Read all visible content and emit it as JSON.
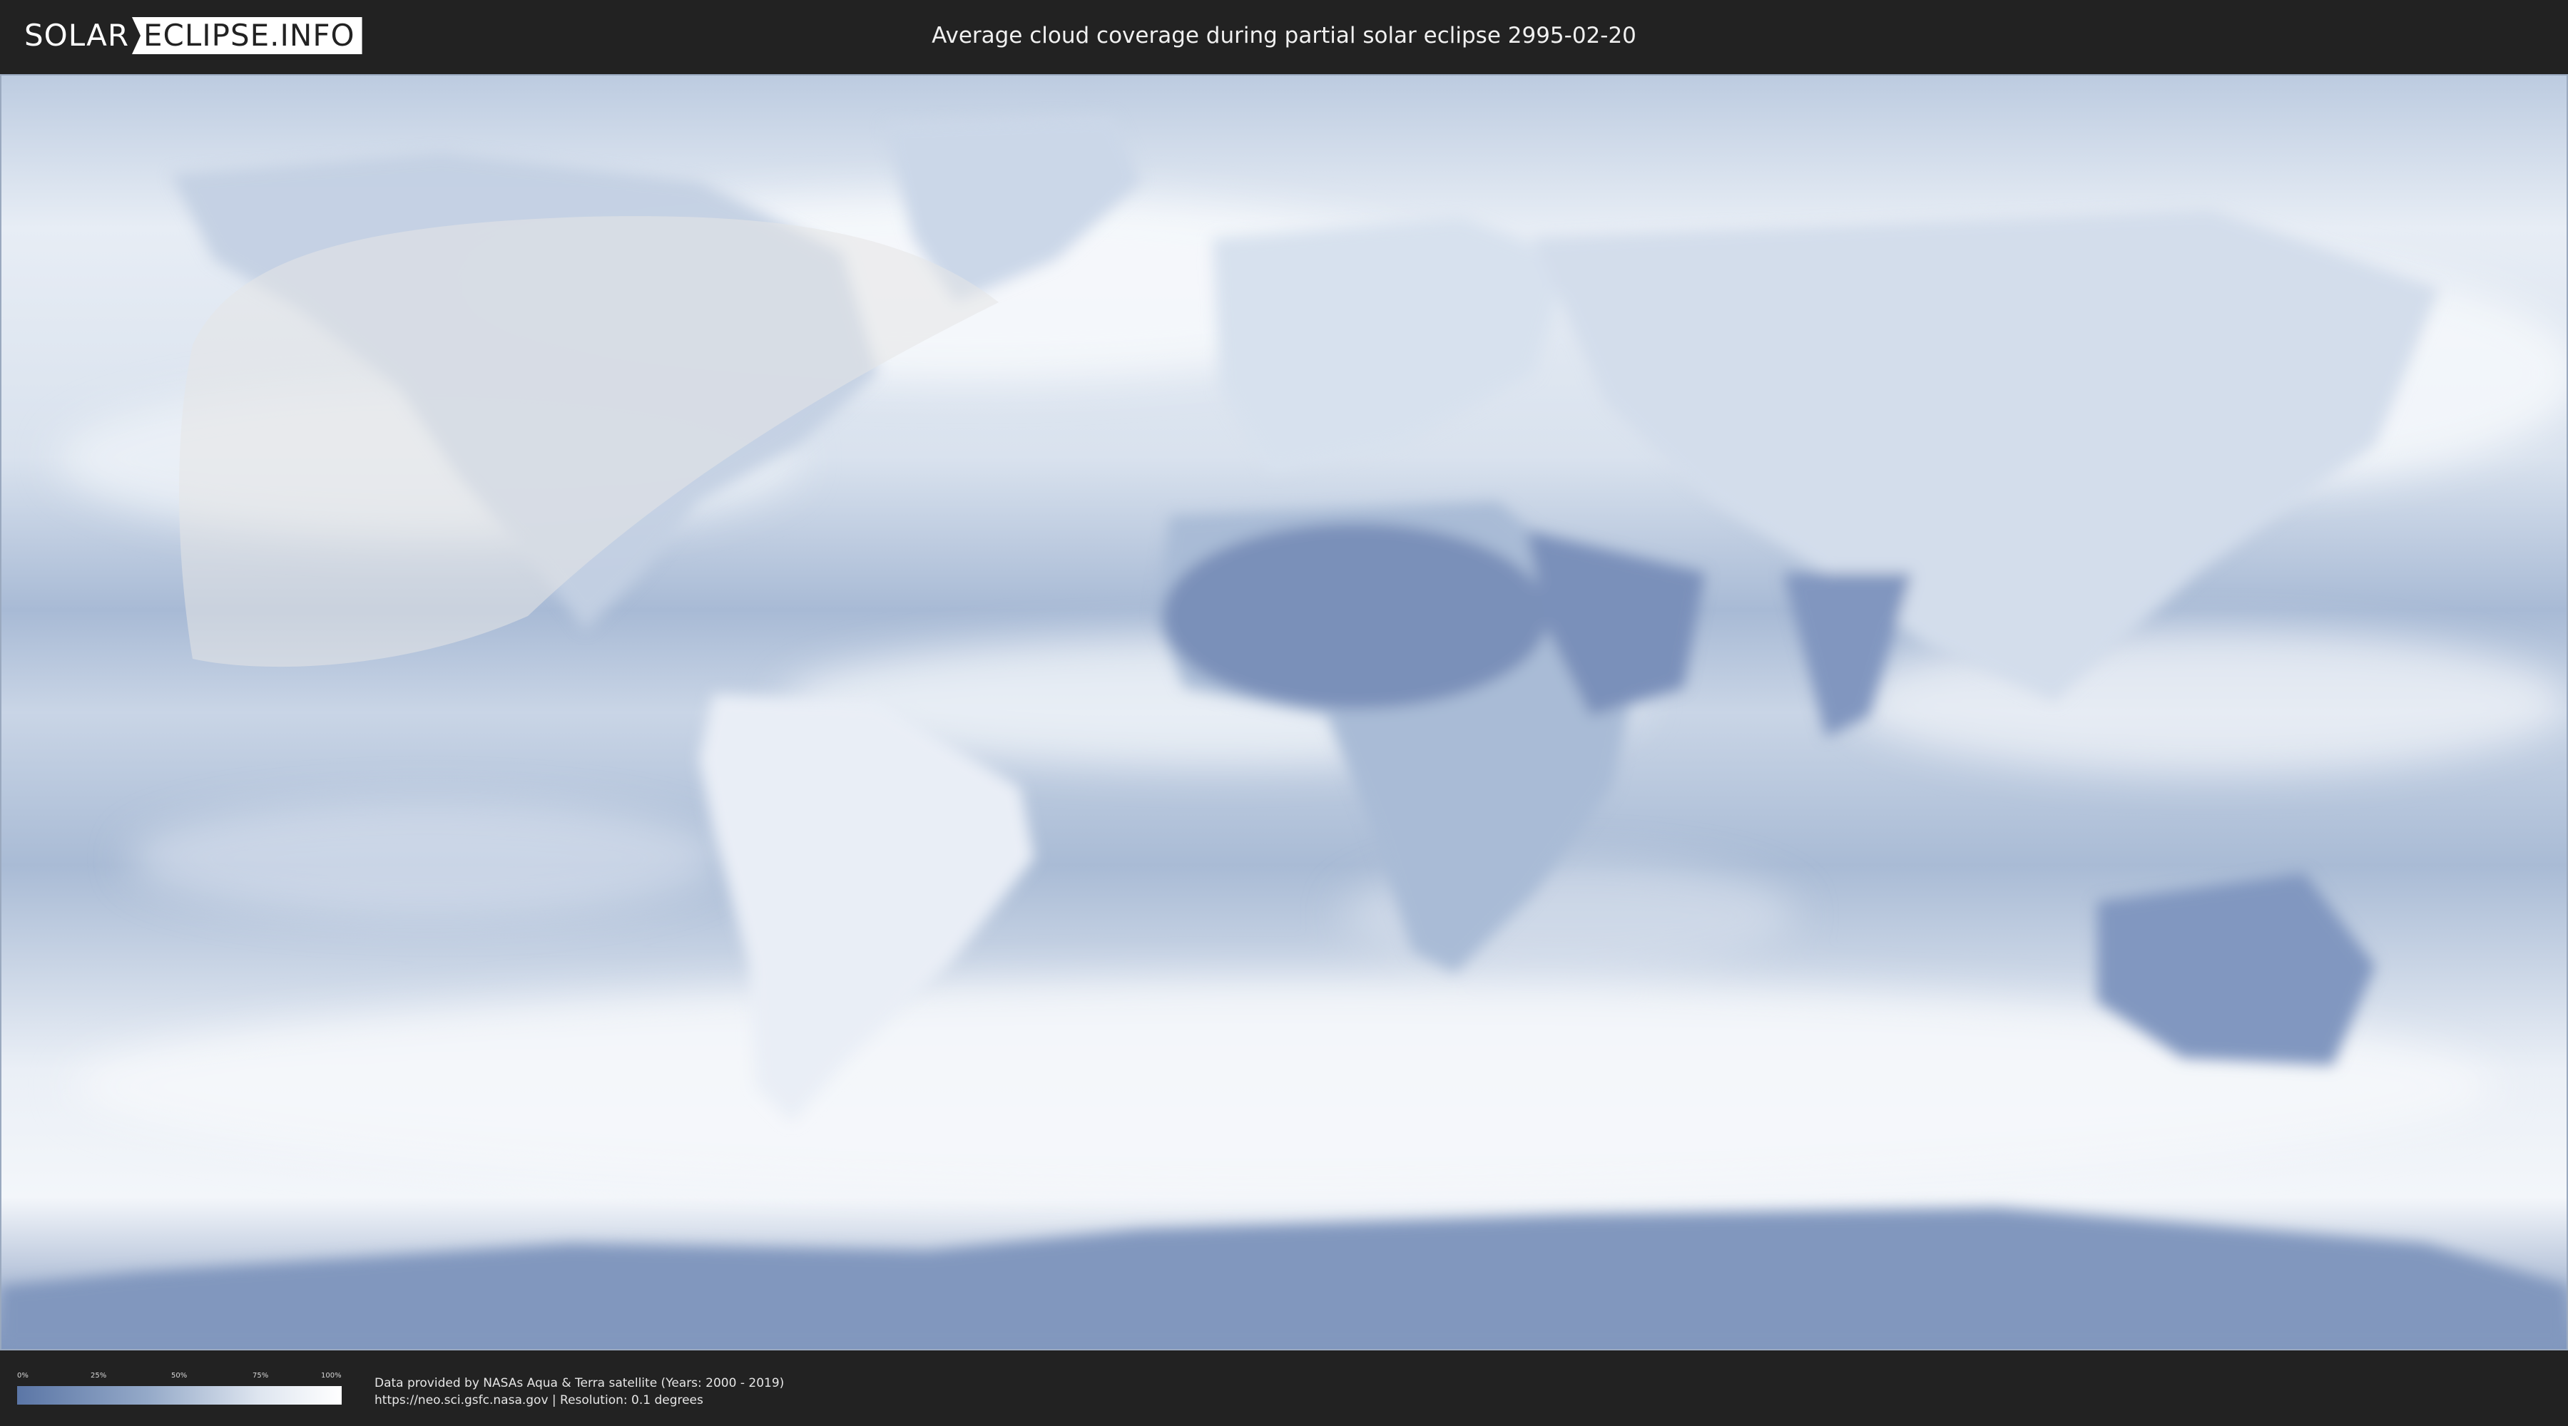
{
  "header": {
    "logo_part1": "SOLAR",
    "logo_part2": "ECLIPSE.INFO",
    "title": "Average cloud coverage during partial solar eclipse 2995-02-20"
  },
  "legend": {
    "ticks": [
      "0%",
      "25%",
      "50%",
      "75%",
      "100%"
    ],
    "colors": {
      "low": "#5b76a6",
      "mid": "#94a9c8",
      "high": "#ffffff"
    }
  },
  "footer": {
    "credit_line1": "Data provided by NASAs Aqua & Terra satellite (Years: 2000 - 2019)",
    "credit_line2": "https://neo.sci.gsfc.nasa.gov | Resolution: 0.1 degrees"
  },
  "colors": {
    "background": "#222222",
    "ocean_clear": "#8ea6c8",
    "cloud": "#f4f7fb",
    "land_clear": "#6f87b4",
    "eclipse_zone": "#e6e6e6"
  }
}
